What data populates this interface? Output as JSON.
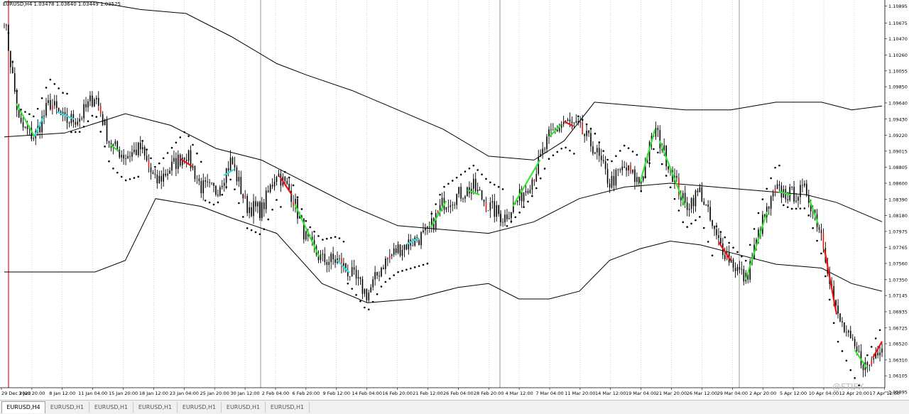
{
  "symbol_line": "EURUSD,H4  1.03478 1.03640 1.03449 1.03525",
  "tabs": [
    {
      "label": "EURUSD,H4",
      "active": true
    },
    {
      "label": "EURUSD,H1",
      "active": false
    },
    {
      "label": "EURUSD,H1",
      "active": false
    },
    {
      "label": "EURUSD,H1",
      "active": false
    },
    {
      "label": "EURUSD,H1",
      "active": false
    },
    {
      "label": "EURUSD,H1",
      "active": false
    },
    {
      "label": "EURUSD,H1",
      "active": false
    }
  ],
  "watermark": "@FTIFX",
  "colors": {
    "background": "#ffffff",
    "grid": "#b0b0b0",
    "line": "#000000",
    "bull": "#33e533",
    "bear": "#ee1111",
    "cyan": "#33dddd",
    "sar": "#000000"
  },
  "chart_data": {
    "type": "candlestick",
    "symbol": "EURUSD",
    "timeframe": "H4",
    "ohlc_readout": {
      "open": 1.03478,
      "high": 1.0364,
      "low": 1.03449,
      "close": 1.03525
    },
    "ylim": [
      1.0595,
      1.109
    ],
    "y_ticks": [
      "1.10895",
      "1.10675",
      "1.10470",
      "1.10260",
      "1.10055",
      "1.09850",
      "1.09640",
      "1.09430",
      "1.09220",
      "1.09015",
      "1.08805",
      "1.08600",
      "1.08390",
      "1.08180",
      "1.07975",
      "1.07765",
      "1.07560",
      "1.07350",
      "1.07145",
      "1.06935",
      "1.06725",
      "1.06520",
      "1.06310",
      "1.06105",
      "1.05895"
    ],
    "x_labels": [
      "29 Dec 2023",
      "3 Jan 20:00",
      "8 Jan 12:00",
      "11 Jan 04:00",
      "15 Jan 20:00",
      "18 Jan 12:00",
      "23 Jan 04:00",
      "25 Jan 20:00",
      "30 Jan 12:00",
      "2 Feb 04:00",
      "6 Feb 20:00",
      "9 Feb 12:00",
      "14 Feb 04:00",
      "16 Feb 20:00",
      "21 Feb 12:00",
      "26 Feb 04:00",
      "28 Feb 20:00",
      "4 Mar 12:00",
      "7 Mar 04:00",
      "11 Mar 20:00",
      "14 Mar 12:00",
      "19 Mar 04:00",
      "21 Mar 20:00",
      "26 Mar 12:00",
      "29 Mar 04:00",
      "2 Apr 20:00",
      "5 Apr 12:00",
      "10 Apr 04:00",
      "12 Apr 20:00",
      "17 Apr 12:00"
    ],
    "price_path": [
      [
        0,
        1.1075
      ],
      [
        1,
        1.0935
      ],
      [
        2,
        1.092
      ],
      [
        3,
        1.0965
      ],
      [
        4,
        1.094
      ],
      [
        5,
        1.0945
      ],
      [
        6,
        1.0975
      ],
      [
        7,
        1.091
      ],
      [
        8,
        1.0895
      ],
      [
        9,
        1.0905
      ],
      [
        10,
        1.086
      ],
      [
        11,
        1.088
      ],
      [
        12,
        1.09
      ],
      [
        13,
        1.0855
      ],
      [
        14,
        1.085
      ],
      [
        15,
        1.089
      ],
      [
        16,
        1.083
      ],
      [
        17,
        1.0825
      ],
      [
        18,
        1.0875
      ],
      [
        19,
        1.0845
      ],
      [
        20,
        1.0785
      ],
      [
        21,
        1.076
      ],
      [
        22,
        1.076
      ],
      [
        23,
        1.074
      ],
      [
        24,
        1.0715
      ],
      [
        25,
        1.0755
      ],
      [
        26,
        1.0775
      ],
      [
        27,
        1.0785
      ],
      [
        28,
        1.0795
      ],
      [
        29,
        1.0835
      ],
      [
        30,
        1.0845
      ],
      [
        31,
        1.0855
      ],
      [
        32,
        1.083
      ],
      [
        33,
        1.0815
      ],
      [
        34,
        1.084
      ],
      [
        35,
        1.087
      ],
      [
        36,
        1.092
      ],
      [
        37,
        1.094
      ],
      [
        38,
        1.093
      ],
      [
        39,
        1.0905
      ],
      [
        40,
        1.086
      ],
      [
        41,
        1.088
      ],
      [
        42,
        1.086
      ],
      [
        43,
        1.093
      ],
      [
        44,
        1.088
      ],
      [
        45,
        1.083
      ],
      [
        46,
        1.085
      ],
      [
        47,
        1.079
      ],
      [
        48,
        1.076
      ],
      [
        49,
        1.0735
      ],
      [
        50,
        1.0805
      ],
      [
        51,
        1.085
      ],
      [
        52,
        1.0845
      ],
      [
        53,
        1.085
      ],
      [
        54,
        1.0795
      ],
      [
        55,
        1.069
      ],
      [
        56,
        1.065
      ],
      [
        57,
        1.062
      ],
      [
        58,
        1.0655
      ]
    ],
    "indicators": [
      {
        "name": "bollinger-upper",
        "path": [
          [
            0,
            1.1095
          ],
          [
            6,
            1.1095
          ],
          [
            9,
            1.1085
          ],
          [
            12,
            1.108
          ],
          [
            15,
            1.105
          ],
          [
            18,
            1.1015
          ],
          [
            20,
            1.1
          ],
          [
            23,
            1.098
          ],
          [
            26,
            1.0955
          ],
          [
            29,
            1.093
          ],
          [
            32,
            1.0895
          ],
          [
            35,
            1.089
          ],
          [
            37,
            1.0915
          ],
          [
            39,
            1.0965
          ],
          [
            42,
            1.096
          ],
          [
            45,
            1.0955
          ],
          [
            48,
            1.0955
          ],
          [
            51,
            1.0965
          ],
          [
            54,
            1.0965
          ],
          [
            56,
            1.0955
          ],
          [
            58,
            1.096
          ]
        ]
      },
      {
        "name": "bollinger-middle",
        "path": [
          [
            0,
            1.092
          ],
          [
            4,
            1.0925
          ],
          [
            8,
            1.095
          ],
          [
            11,
            1.0935
          ],
          [
            14,
            1.0905
          ],
          [
            17,
            1.089
          ],
          [
            20,
            1.086
          ],
          [
            23,
            1.083
          ],
          [
            26,
            1.0805
          ],
          [
            29,
            1.08
          ],
          [
            32,
            1.0795
          ],
          [
            35,
            1.081
          ],
          [
            38,
            1.084
          ],
          [
            41,
            1.0855
          ],
          [
            44,
            1.086
          ],
          [
            47,
            1.0855
          ],
          [
            50,
            1.085
          ],
          [
            53,
            1.0845
          ],
          [
            55,
            1.0835
          ],
          [
            58,
            1.081
          ]
        ]
      },
      {
        "name": "bollinger-lower",
        "path": [
          [
            0,
            1.0745
          ],
          [
            6,
            1.0745
          ],
          [
            8,
            1.076
          ],
          [
            10,
            1.084
          ],
          [
            13,
            1.083
          ],
          [
            15,
            1.0815
          ],
          [
            18,
            1.0795
          ],
          [
            21,
            1.073
          ],
          [
            24,
            1.0705
          ],
          [
            27,
            1.071
          ],
          [
            30,
            1.0725
          ],
          [
            32,
            1.073
          ],
          [
            34,
            1.071
          ],
          [
            36,
            1.071
          ],
          [
            38,
            1.072
          ],
          [
            40,
            1.076
          ],
          [
            42,
            1.0775
          ],
          [
            44,
            1.0785
          ],
          [
            46,
            1.078
          ],
          [
            48,
            1.077
          ],
          [
            51,
            1.0755
          ],
          [
            54,
            1.075
          ],
          [
            56,
            1.073
          ],
          [
            58,
            1.072
          ]
        ]
      }
    ]
  }
}
